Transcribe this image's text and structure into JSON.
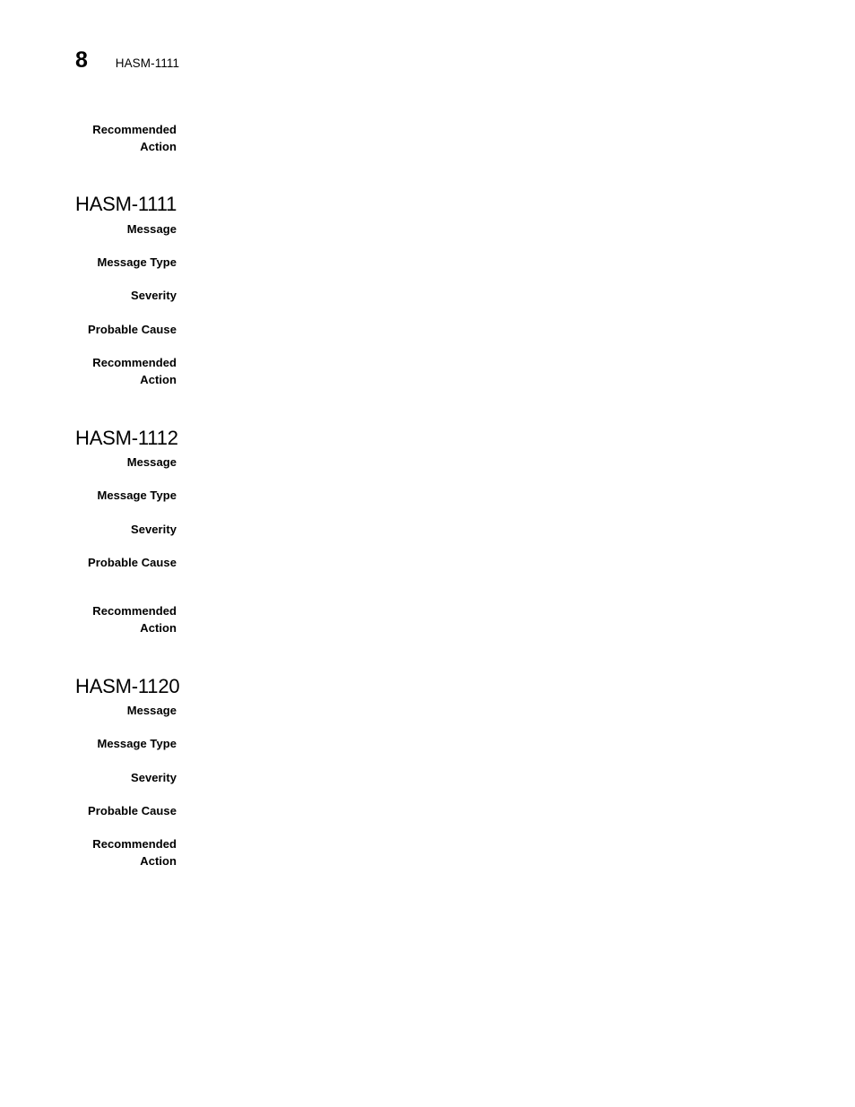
{
  "page": {
    "number": "8",
    "running_header": "HASM-1111",
    "background_color": "#ffffff",
    "text_color": "#000000"
  },
  "continued_block": {
    "label": "Recommended\nAction",
    "value": ""
  },
  "sections": [
    {
      "heading": "HASM-1111",
      "fields": [
        {
          "label": "Message",
          "value": ""
        },
        {
          "label": "Message Type",
          "value": ""
        },
        {
          "label": "Severity",
          "value": ""
        },
        {
          "label": "Probable Cause",
          "value": ""
        },
        {
          "label": "Recommended\nAction",
          "value": ""
        }
      ]
    },
    {
      "heading": "HASM-1112",
      "fields": [
        {
          "label": "Message",
          "value": ""
        },
        {
          "label": "Message Type",
          "value": ""
        },
        {
          "label": "Severity",
          "value": ""
        },
        {
          "label": "Probable Cause",
          "value": ""
        },
        {
          "label": "Recommended\nAction",
          "value": ""
        }
      ]
    },
    {
      "heading": "HASM-1120",
      "fields": [
        {
          "label": "Message",
          "value": ""
        },
        {
          "label": "Message Type",
          "value": ""
        },
        {
          "label": "Severity",
          "value": ""
        },
        {
          "label": "Probable Cause",
          "value": ""
        },
        {
          "label": "Recommended\nAction",
          "value": ""
        }
      ]
    }
  ]
}
